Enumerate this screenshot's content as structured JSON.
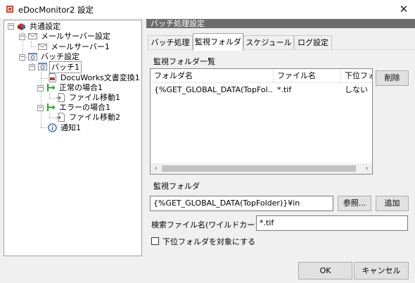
{
  "window": {
    "title": "eDocMonitor2 設定",
    "close_glyph": "✕"
  },
  "tree": {
    "common": "共通設定",
    "mail_server_settings": "メールサーバー設定",
    "mail_server_1": "メールサーバー1",
    "batch_settings": "バッチ設定",
    "batch_1": "バッチ1",
    "docuworks_convert_1": "DocuWorks文書変換1",
    "on_success_1": "正常の場合1",
    "file_move_1": "ファイル移動1",
    "on_error_1": "エラーの場合1",
    "file_move_2": "ファイル移動2",
    "notify_1": "通知1",
    "collapse_glyph": "−"
  },
  "section_header": "バッチ処理設定",
  "tabs": [
    "バッチ処理",
    "監視フォルダ",
    "スケジュール",
    "ログ設定"
  ],
  "active_tab": "監視フォルダ",
  "watch_list": {
    "label": "監視フォルダ一覧",
    "columns": [
      "フォルダ名",
      "ファイル名",
      "下位フォルダ"
    ],
    "rows": [
      [
        "{%GET_GLOBAL_DATA(TopFol...",
        "*.tif",
        "しない"
      ]
    ]
  },
  "buttons": {
    "delete": "削除",
    "browse": "参照...",
    "add": "追加",
    "ok": "OK",
    "cancel": "キャンセル"
  },
  "watch_folder": {
    "label": "監視フォルダ",
    "value": "{%GET_GLOBAL_DATA(TopFolder)}¥in"
  },
  "search_file": {
    "label": "検索ファイル名(ワイルドカード)",
    "value": "*.tif"
  },
  "subfolder_checkbox": {
    "label": "下位フォルダを対象にする",
    "checked": false
  },
  "icons": {
    "app": "app-icon",
    "close": "close-icon"
  },
  "colors": {
    "section_header_bg": "#6d6d6d",
    "run_arrow": "#2aa52a"
  }
}
